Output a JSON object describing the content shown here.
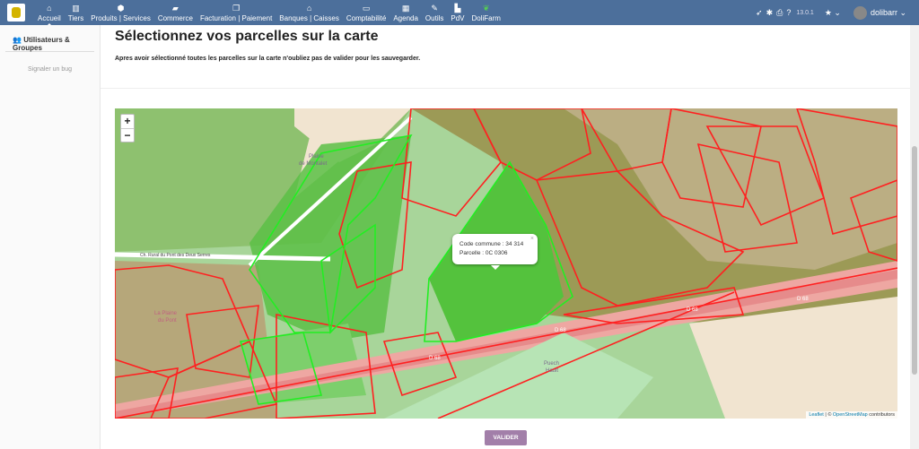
{
  "topbar": {
    "menu": [
      {
        "label": "Accueil",
        "icon": "home-icon",
        "glyph": "⌂"
      },
      {
        "label": "Tiers",
        "icon": "building-icon",
        "glyph": "▥"
      },
      {
        "label": "Produits | Services",
        "icon": "cube-icon",
        "glyph": "⬢"
      },
      {
        "label": "Commerce",
        "icon": "briefcase-icon",
        "glyph": "▰"
      },
      {
        "label": "Facturation | Paiement",
        "icon": "invoice-icon",
        "glyph": "❐"
      },
      {
        "label": "Banques | Caisses",
        "icon": "bank-icon",
        "glyph": "⌂"
      },
      {
        "label": "Comptabilité",
        "icon": "accounting-icon",
        "glyph": "▭"
      },
      {
        "label": "Agenda",
        "icon": "calendar-icon",
        "glyph": "▦"
      },
      {
        "label": "Outils",
        "icon": "wrench-icon",
        "glyph": "✎"
      },
      {
        "label": "PdV",
        "icon": "cash-register-icon",
        "glyph": "▙"
      },
      {
        "label": "DoliFarm",
        "icon": "sprout-icon",
        "glyph": "❦"
      }
    ],
    "version": "13.0.1",
    "user": "dolibarr"
  },
  "sidebar": {
    "title": "Utilisateurs & Groupes",
    "link": "Signaler un bug"
  },
  "main": {
    "title": "Sélectionnez vos parcelles sur la carte",
    "intro": "Apres avoir sélectionné toutes les parcelles sur la carte n'oubliez pas de valider pour les sauvegarder.",
    "validate": "VALIDER"
  },
  "map": {
    "zoom_in": "+",
    "zoom_out": "−",
    "popup": {
      "line1": "Code commune : 34 314",
      "line2": "Parcelle : 0C 0306",
      "close": "×"
    },
    "labels": {
      "plaine_montalet_1": "Plaine",
      "plaine_montalet_2": "de Montalet",
      "chemin": "Ch. Rural du Pont des Deux Serres",
      "plaine_pont_1": "La Plaine",
      "plaine_pont_2": "du Pont",
      "d68": "D 68",
      "puech_1": "Puech",
      "puech_2": "Hault"
    },
    "attribution": {
      "leaflet": "Leaflet",
      "sep": " | © ",
      "osm": "OpenStreetMap",
      "suffix": " contributors"
    }
  }
}
